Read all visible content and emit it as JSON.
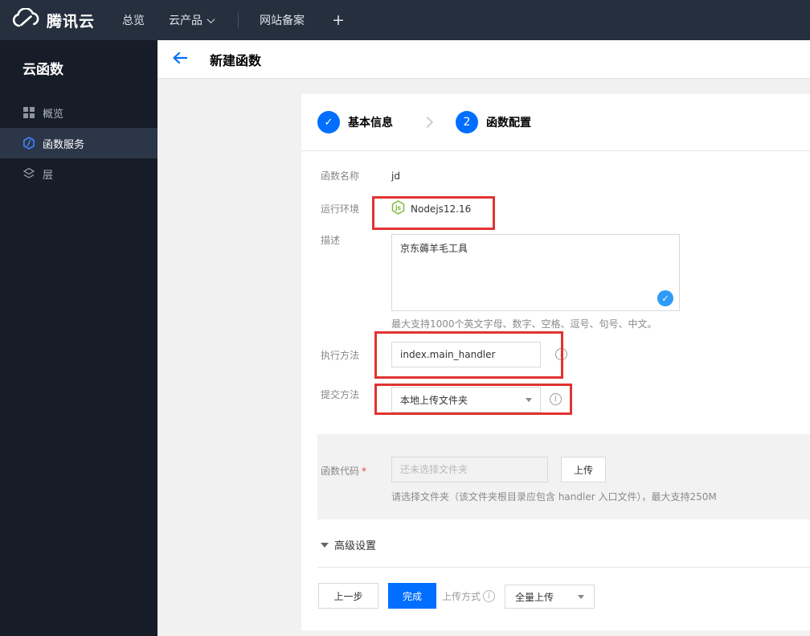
{
  "colors": {
    "accent_blue": "#006eff",
    "annotation_red": "#e23333",
    "node_green": "#7fb93c",
    "badge_blue": "#2f9bf6",
    "topbar_bg": "#252f3e",
    "sidebar_bg": "#161c28"
  },
  "topbar": {
    "brand": "腾讯云",
    "nav": [
      {
        "label": "总览"
      },
      {
        "label": "云产品"
      },
      {
        "label": "网站备案"
      },
      {
        "label": "+"
      }
    ]
  },
  "sidebar": {
    "title": "云函数",
    "items": [
      {
        "label": "概览",
        "icon": "grid-icon",
        "active": false
      },
      {
        "label": "函数服务",
        "icon": "scf-hexagon-icon",
        "active": true
      },
      {
        "label": "层",
        "icon": "layers-icon",
        "active": false
      }
    ]
  },
  "header": {
    "title": "新建函数"
  },
  "stepper": {
    "step1_label": "基本信息",
    "step1_check": "✓",
    "step2_number": "2",
    "step2_label": "函数配置"
  },
  "form": {
    "name_label": "函数名称",
    "name_value": "jd",
    "runtime_label": "运行环境",
    "runtime_value": "Nodejs12.16",
    "runtime_icon_text": "js",
    "desc_label": "描述",
    "desc_value": "京东薅羊毛工具",
    "desc_valid_check": "✓",
    "desc_hint": "最大支持1000个英文字母、数字、空格、逗号、句号、中文。",
    "handler_label": "执行方法",
    "handler_value": "index.main_handler",
    "submit_label": "提交方法",
    "submit_value": "本地上传文件夹",
    "info_glyph": "i",
    "code_label": "函数代码",
    "required_mark": "*",
    "code_placeholder": "还未选择文件夹",
    "upload_button": "上传",
    "code_hint": "请选择文件夹（该文件夹根目录应包含 handler 入口文件），最大支持250M",
    "advanced_label": "高级设置"
  },
  "footer": {
    "prev_button": "上一步",
    "finish_button": "完成",
    "upload_mode_label": "上传方式",
    "upload_mode_value": "全量上传"
  }
}
